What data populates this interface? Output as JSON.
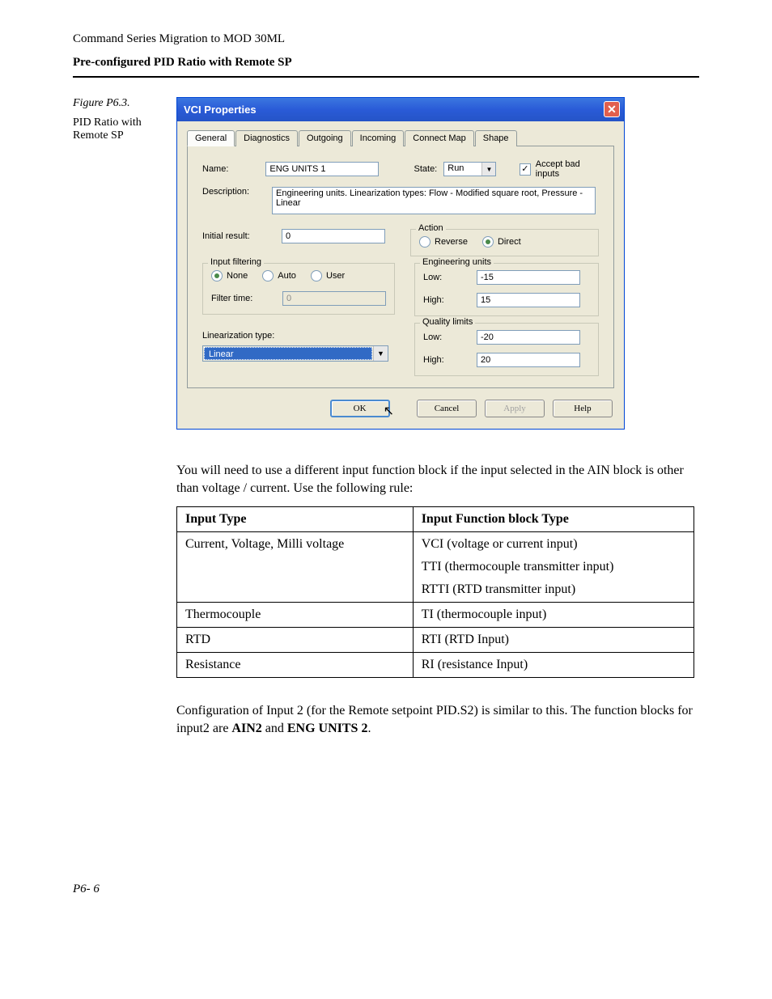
{
  "doc": {
    "header_small": "Command Series Migration to MOD 30ML",
    "header_bold": "Pre-configured PID Ratio with Remote SP",
    "figure_title": "Figure P6.3.",
    "figure_sub": "PID Ratio with Remote SP",
    "para1": "You will need to use a different input function block if the input selected in the AIN block is other than voltage / current. Use the following rule:",
    "table": {
      "h1": "Input Type",
      "h2": "Input Function block Type",
      "rows": [
        {
          "c1": "Current, Voltage, Milli voltage",
          "c2a": "VCI (voltage or current input)",
          "c2b": "TTI (thermocouple transmitter input)",
          "c2c": "RTTI (RTD transmitter input)"
        },
        {
          "c1": "Thermocouple",
          "c2": "TI (thermocouple input)"
        },
        {
          "c1": "RTD",
          "c2": "RTI (RTD Input)"
        },
        {
          "c1": "Resistance",
          "c2": "RI (resistance Input)"
        }
      ]
    },
    "para2a": "Configuration of Input 2 (for the Remote setpoint PID.S2) is similar to this.  The function blocks for input2 are ",
    "para2b": "AIN2",
    "para2c": " and ",
    "para2d": "ENG UNITS 2",
    "para2e": ".",
    "page_num": "P6- 6"
  },
  "dlg": {
    "title": "VCI Properties",
    "tabs": [
      "General",
      "Diagnostics",
      "Outgoing",
      "Incoming",
      "Connect Map",
      "Shape"
    ],
    "name_label": "Name:",
    "name_value": "ENG UNITS 1",
    "state_label": "State:",
    "state_value": "Run",
    "accept_bad": "Accept bad inputs",
    "desc_label": "Description:",
    "desc_value": "Engineering units. Linearization types: Flow - Modified square root, Pressure - Linear",
    "initial_result_label": "Initial result:",
    "initial_result_value": "0",
    "action_legend": "Action",
    "action_reverse": "Reverse",
    "action_direct": "Direct",
    "input_filtering_legend": "Input filtering",
    "filter_none": "None",
    "filter_auto": "Auto",
    "filter_user": "User",
    "filter_time_label": "Filter time:",
    "filter_time_value": "0",
    "eng_legend": "Engineering units",
    "eng_low_label": "Low:",
    "eng_low_value": "-15",
    "eng_high_label": "High:",
    "eng_high_value": "15",
    "quality_legend": "Quality limits",
    "q_low_label": "Low:",
    "q_low_value": "-20",
    "q_high_label": "High:",
    "q_high_value": "20",
    "lin_label": "Linearization type:",
    "lin_value": "Linear",
    "btn_ok": "OK",
    "btn_cancel": "Cancel",
    "btn_apply": "Apply",
    "btn_help": "Help"
  }
}
